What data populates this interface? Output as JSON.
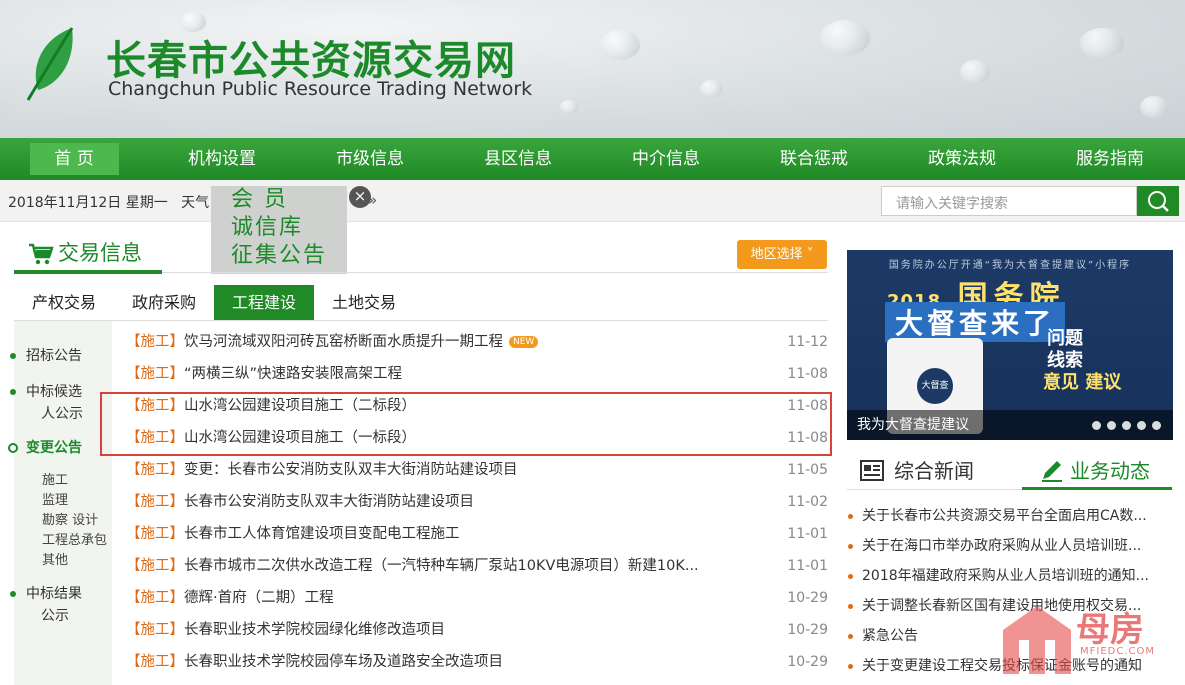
{
  "site": {
    "title_cn": "长春市公共资源交易网",
    "title_en": "Changchun Public Resource Trading Network"
  },
  "nav": [
    {
      "label": "首 页",
      "active": true
    },
    {
      "label": "机构设置"
    },
    {
      "label": "市级信息"
    },
    {
      "label": "县区信息"
    },
    {
      "label": "中介信息"
    },
    {
      "label": "联合惩戒"
    },
    {
      "label": "政策法规"
    },
    {
      "label": "服务指南"
    }
  ],
  "infobar": {
    "date": "2018年11月12日 星期一",
    "weather_label": "天气",
    "more": "»"
  },
  "search": {
    "placeholder": "请输入关键字搜索"
  },
  "popup": {
    "line1": "会 员",
    "line2": "诚信库",
    "line3": "征集公告",
    "close": "×"
  },
  "section": {
    "title": "交易信息",
    "region_button": "地区选择 ˅"
  },
  "tabs": [
    {
      "label": "产权交易"
    },
    {
      "label": "政府采购"
    },
    {
      "label": "工程建设",
      "active": true
    },
    {
      "label": "土地交易"
    }
  ],
  "sidebar": {
    "items": [
      {
        "label": "招标公告"
      },
      {
        "label": "中标候选"
      },
      {
        "label": "人公示"
      },
      {
        "label": "变更公告",
        "active": true
      },
      {
        "label": "中标结果"
      },
      {
        "label": "公示"
      }
    ],
    "subitems": [
      "施工",
      "监理",
      "勘察 设计",
      "工程总承包",
      "其他"
    ]
  },
  "list": [
    {
      "tag": "【施工】",
      "title": "饮马河流域双阳河砖瓦窑桥断面水质提升一期工程",
      "badge": "NEW",
      "date": "11-12"
    },
    {
      "tag": "【施工】",
      "title": "“两横三纵”快速路安装限高架工程",
      "date": "11-08"
    },
    {
      "tag": "【施工】",
      "title": "山水湾公园建设项目施工（二标段）",
      "date": "11-08"
    },
    {
      "tag": "【施工】",
      "title": "山水湾公园建设项目施工（一标段）",
      "date": "11-08"
    },
    {
      "tag": "【施工】",
      "title": "变更：长春市公安消防支队双丰大街消防站建设项目",
      "date": "11-05"
    },
    {
      "tag": "【施工】",
      "title": "长春市公安消防支队双丰大街消防站建设项目",
      "date": "11-02"
    },
    {
      "tag": "【施工】",
      "title": "长春市工人体育馆建设项目变配电工程施工",
      "date": "11-01"
    },
    {
      "tag": "【施工】",
      "title": "长春市城市二次供水改造工程（一汽特种车辆厂泵站10KV电源项目）新建10K...",
      "date": "11-01"
    },
    {
      "tag": "【施工】",
      "title": "德辉·首府（二期）工程",
      "date": "10-29"
    },
    {
      "tag": "【施工】",
      "title": "长春职业技术学院校园绿化维修改造项目",
      "date": "10-29"
    },
    {
      "tag": "【施工】",
      "title": "长春职业技术学院校园停车场及道路安全改造项目",
      "date": "10-29"
    }
  ],
  "banner": {
    "top_text": "国务院办公厅开通“我为大督查提建议”小程序",
    "year": "2018",
    "headline1": "国务院",
    "headline2": "大督查来了",
    "right1": "问题",
    "right2": "线索",
    "right3": "意见 建议",
    "qr_label": "大督查",
    "caption": "我为大督查提建议"
  },
  "news": {
    "tab1": "综合新闻",
    "tab2": "业务动态",
    "items": [
      "关于长春市公共资源交易平台全面启用CA数...",
      "关于在海口市举办政府采购从业人员培训班...",
      "2018年福建政府采购从业人员培训班的通知...",
      "关于调整长春新区国有建设用地使用权交易...",
      "紧急公告",
      "关于变更建设工程交易投标保证金账号的通知"
    ]
  },
  "watermark": {
    "text": "母房",
    "sub": "MFIEDC.COM"
  },
  "colors": {
    "brand_green": "#1f8a26",
    "accent_orange": "#e06b14",
    "highlight_red": "#d9423b"
  }
}
